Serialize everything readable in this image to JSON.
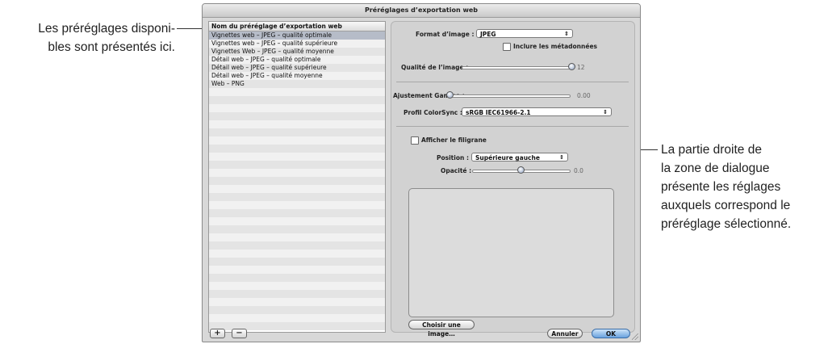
{
  "callouts": {
    "left_line1": "Les préréglages disponi-",
    "left_line2": "bles sont présentés ici.",
    "right_line1": "La partie droite de",
    "right_line2": "la zone de dialogue",
    "right_line3": "présente les réglages",
    "right_line4": "auxquels correspond le",
    "right_line5": "préréglage sélectionné."
  },
  "window": {
    "title": "Préréglages d’exportation web"
  },
  "preset_list": {
    "header": "Nom du préréglage d’exportation web",
    "items": [
      {
        "label": "Vignettes web – JPEG – qualité optimale",
        "selected": true
      },
      {
        "label": "Vignettes web – JPEG – qualité supérieure",
        "selected": false
      },
      {
        "label": "Vignettes Web – JPEG – qualité moyenne",
        "selected": false
      },
      {
        "label": "Détail web – JPEG – qualité optimale",
        "selected": false
      },
      {
        "label": "Détail web – JPEG – qualité supérieure",
        "selected": false
      },
      {
        "label": "Détail web – JPEG – qualité moyenne",
        "selected": false
      },
      {
        "label": "Web – PNG",
        "selected": false
      }
    ]
  },
  "settings": {
    "format_label": "Format d’image :",
    "format_value": "JPEG",
    "include_metadata_label": "Inclure les métadonnées",
    "include_metadata_checked": false,
    "quality_label": "Qualité de l’image :",
    "quality_value": "12",
    "quality_level": 1.0,
    "gamma_label": "Ajustement Gamma :",
    "gamma_value": "0.00",
    "gamma_level": 0.0,
    "colorsync_label": "Profil ColorSync :",
    "colorsync_value": "sRGB IEC61966-2.1",
    "watermark_label": "Afficher le filigrane",
    "watermark_checked": false,
    "position_label": "Position :",
    "position_value": "Supérieure gauche",
    "opacity_label": "Opacité :",
    "opacity_value": "0.0",
    "opacity_level": 0.5,
    "choose_image_label": "Choisir une image…"
  },
  "buttons": {
    "add": "+",
    "remove": "−",
    "cancel": "Annuler",
    "ok": "OK"
  },
  "icons": {
    "popup_arrows": "⇕",
    "resize": "resize-grip-icon"
  }
}
